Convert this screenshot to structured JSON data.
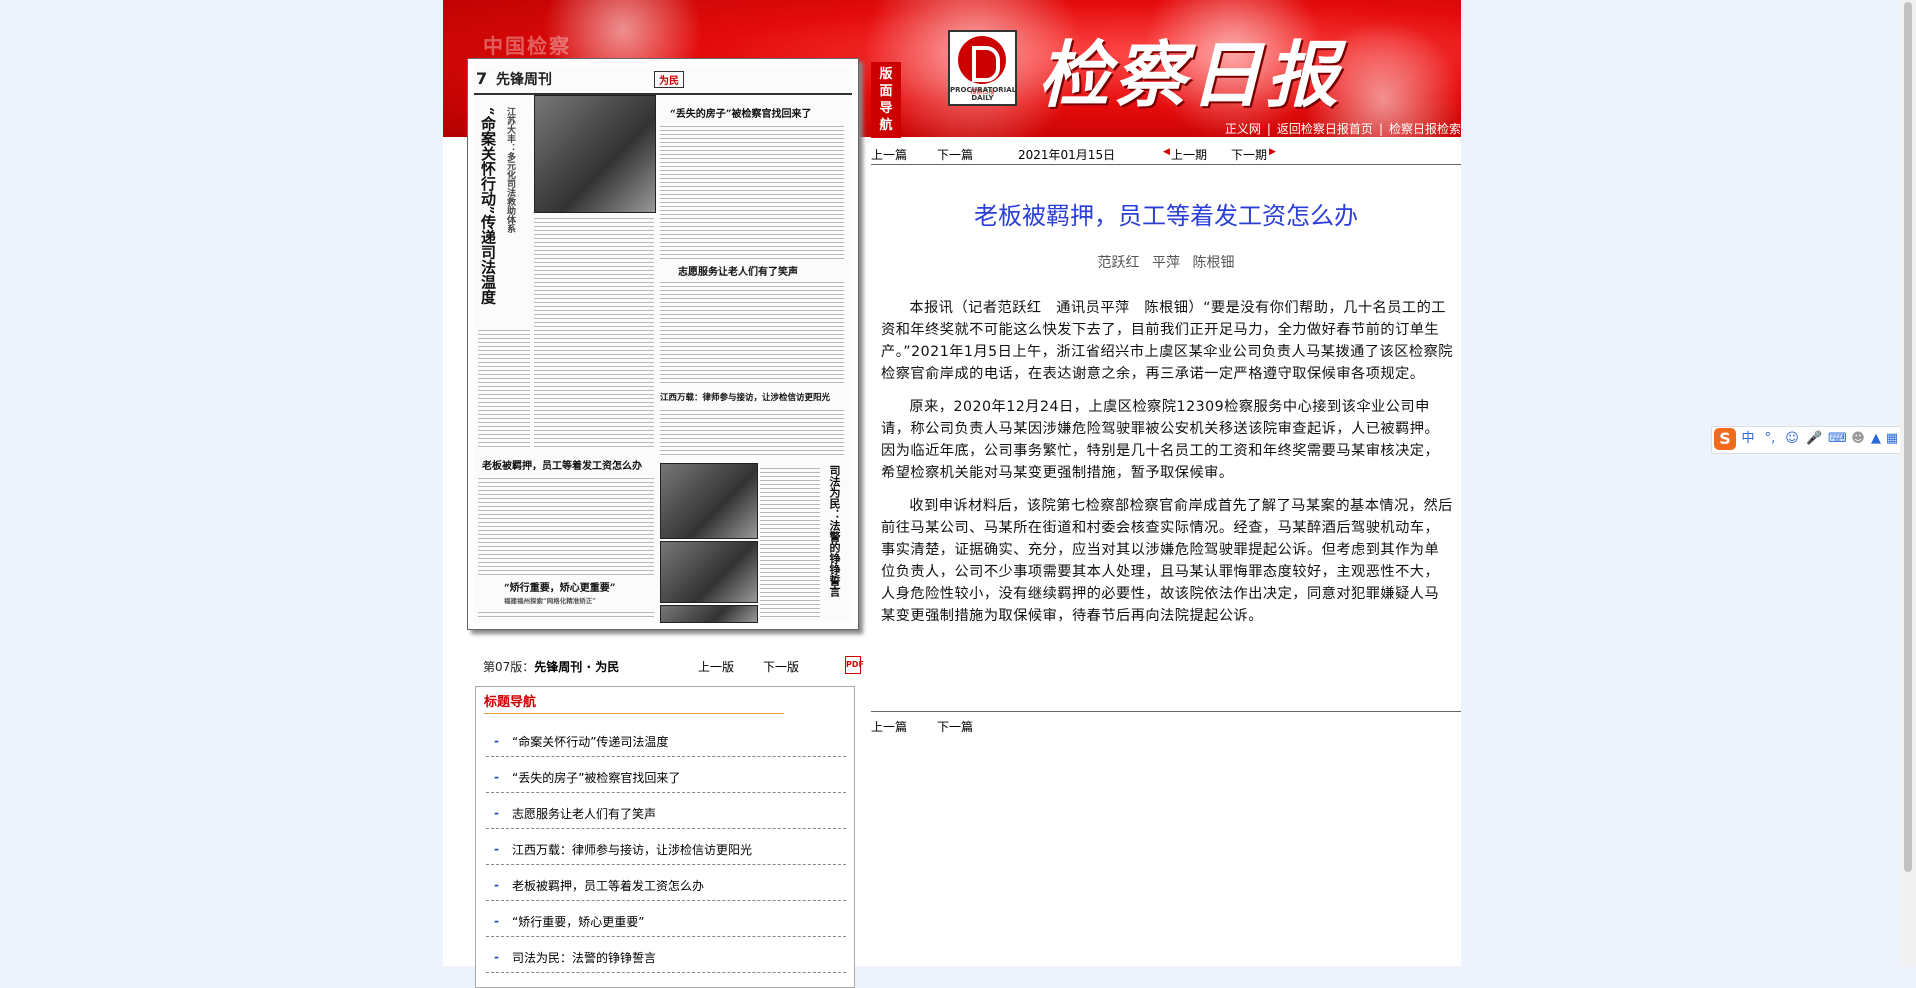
{
  "header": {
    "masthead": "检察日报",
    "faint_logo": "中国检察",
    "logo_caption": "检察日报",
    "logo_caption_en": "PROCURATORIAL DAILY",
    "nav_side_label": "版面导航",
    "links": [
      "正义网",
      "返回检察日报首页",
      "检察日报检索"
    ],
    "colors": {
      "header_red": "#e40b0b",
      "title_blue": "#2b3ed6",
      "accent_red": "#cc0000"
    }
  },
  "paper": {
    "page_number": "7",
    "brand": "先锋周刊",
    "section_tag": "为民",
    "headlines": {
      "vertical_main": "“命案关怀行动”传递司法温度",
      "vertical_sub": "江苏大丰：多元化司法救助体系",
      "h1": "“丢失的房子”被检察官找回来了",
      "h2": "志愿服务让老人们有了笑声",
      "h3": "江西万载：律师参与接访，让涉检信访更阳光",
      "h4": "老板被羁押，员工等着发工资怎么办",
      "h5": "“矫行重要，矫心更重要”",
      "h5_sub": "福建福州探索“网格化精准矫正”",
      "vertical_side": "司法为民：法警的铮铮誓言"
    }
  },
  "page_bar": {
    "label": "第07版：",
    "label_bold": "先锋周刊 · 为民",
    "prev": "上一版",
    "next": "下一版",
    "pdf_icon": "pdf-icon"
  },
  "title_nav": {
    "heading": "标题导航",
    "items": [
      "“命案关怀行动”传递司法温度",
      "“丢失的房子”被检察官找回来了",
      "志愿服务让老人们有了笑声",
      "江西万载：律师参与接访，让涉检信访更阳光",
      "老板被羁押，员工等着发工资怎么办",
      "“矫行重要，矫心更重要”",
      "司法为民：法警的铮铮誓言"
    ]
  },
  "article_bar": {
    "prev_article": "上一篇",
    "next_article": "下一篇",
    "date": "2021年01月15日",
    "prev_issue": "上一期",
    "next_issue": "下一期"
  },
  "article": {
    "title": "老板被羁押，员工等着发工资怎么办",
    "authors": "范跃红  平萍  陈根钿",
    "paragraphs": [
      "本报讯（记者范跃红　通讯员平萍　陈根钿）“要是没有你们帮助，几十名员工的工资和年终奖就不可能这么快发下去了，目前我们正开足马力，全力做好春节前的订单生产。”2021年1月5日上午，浙江省绍兴市上虞区某伞业公司负责人马某拨通了该区检察院检察官俞岸成的电话，在表达谢意之余，再三承诺一定严格遵守取保候审各项规定。",
      "原来，2020年12月24日，上虞区检察院12309检察服务中心接到该伞业公司申请，称公司负责人马某因涉嫌危险驾驶罪被公安机关移送该院审查起诉，人已被羁押。因为临近年底，公司事务繁忙，特别是几十名员工的工资和年终奖需要马某审核决定，希望检察机关能对马某变更强制措施，暂予取保候审。",
      "收到申诉材料后，该院第七检察部检察官俞岸成首先了解了马某案的基本情况，然后前往马某公司、马某所在街道和村委会核查实际情况。经查，马某醉酒后驾驶机动车，事实清楚，证据确实、充分，应当对其以涉嫌危险驾驶罪提起公诉。但考虑到其作为单位负责人，公司不少事项需要其本人处理，且马某认罪悔罪态度较好，主观恶性不大，人身危险性较小，没有继续羁押的必要性，故该院依法作出决定，同意对犯罪嫌疑人马某变更强制措施为取保候审，待春节后再向法院提起公诉。"
    ]
  },
  "article_footer": {
    "prev_article": "上一篇",
    "next_article": "下一篇"
  },
  "ime": {
    "logo": "S",
    "mode": "中",
    "icons": [
      "punctuation-icon",
      "emoji-icon",
      "microphone-icon",
      "keyboard-icon",
      "user-icon",
      "skin-icon",
      "grid-icon"
    ]
  }
}
